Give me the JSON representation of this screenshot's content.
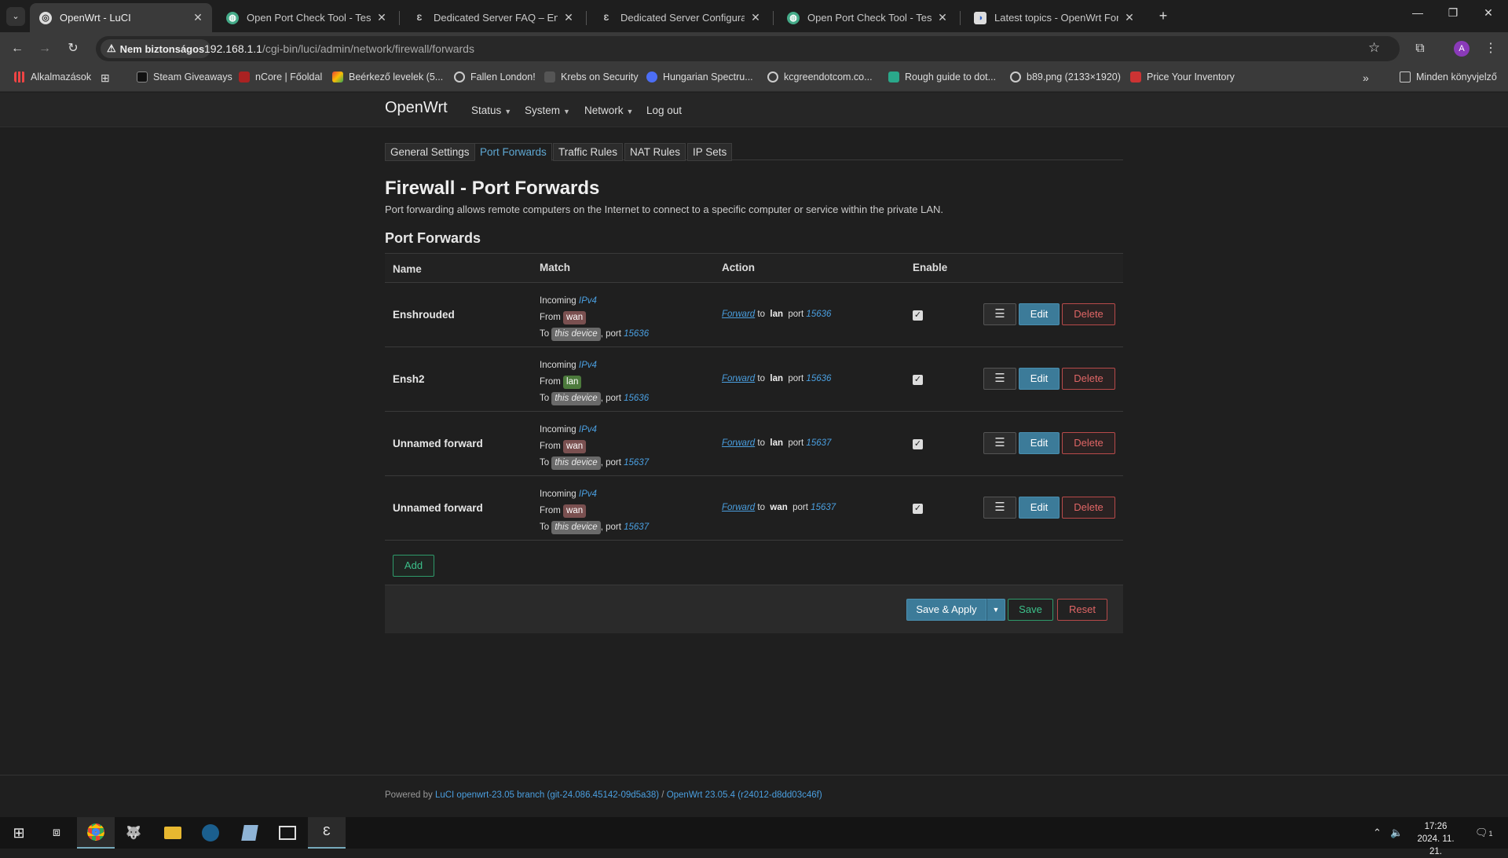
{
  "browser": {
    "tabs": [
      {
        "title": "OpenWrt - LuCI",
        "active": true
      },
      {
        "title": "Open Port Check Tool - Test Por",
        "active": false
      },
      {
        "title": "Dedicated Server FAQ – Enshrou",
        "active": false
      },
      {
        "title": "Dedicated Server Configuration",
        "active": false
      },
      {
        "title": "Open Port Check Tool - Test Por",
        "active": false
      },
      {
        "title": "Latest topics - OpenWrt Forum",
        "active": false
      }
    ],
    "new_tab": "+",
    "security_chip": "Nem biztonságos",
    "url_host": "192.168.1.1",
    "url_path": "/cgi-bin/luci/admin/network/firewall/forwards",
    "bookmarks": [
      "Alkalmazások",
      "Steam Giveaways",
      "nCore | Főoldal",
      "Beérkező levelek (5...",
      "Fallen London!",
      "Krebs on Security",
      "Hungarian Spectru...",
      "kcgreendotcom.co...",
      "Rough guide to dot...",
      "b89.png (2133×1920)",
      "Price Your Inventory"
    ],
    "bookmarks_folder": "Minden könyvjelző",
    "profile_initial": "A"
  },
  "luci": {
    "brand": "OpenWrt",
    "menu": [
      "Status",
      "System",
      "Network",
      "Log out"
    ],
    "subtabs": [
      "General Settings",
      "Port Forwards",
      "Traffic Rules",
      "NAT Rules",
      "IP Sets"
    ],
    "active_subtab": "Port Forwards",
    "title": "Firewall - Port Forwards",
    "description": "Port forwarding allows remote computers on the Internet to connect to a specific computer or service within the private LAN.",
    "section_title": "Port Forwards",
    "columns": [
      "Name",
      "Match",
      "Action",
      "Enable"
    ],
    "rules": [
      {
        "name": "Enshrouded",
        "family": "IPv4",
        "from_zone": "wan",
        "to": "this device",
        "port": "15636",
        "action": "Forward",
        "dest_zone": "lan",
        "dest_port": "15636",
        "enabled": true
      },
      {
        "name": "Ensh2",
        "family": "IPv4",
        "from_zone": "lan",
        "to": "this device",
        "port": "15636",
        "action": "Forward",
        "dest_zone": "lan",
        "dest_port": "15636",
        "enabled": true
      },
      {
        "name": "Unnamed forward",
        "family": "IPv4",
        "from_zone": "wan",
        "to": "this device",
        "port": "15637",
        "action": "Forward",
        "dest_zone": "lan",
        "dest_port": "15637",
        "enabled": true
      },
      {
        "name": "Unnamed forward",
        "family": "IPv4",
        "from_zone": "wan",
        "to": "this device",
        "port": "15637",
        "action": "Forward",
        "dest_zone": "wan",
        "dest_port": "15637",
        "enabled": true
      }
    ],
    "labels": {
      "incoming": "Incoming",
      "from": "From",
      "to": "To",
      "port": ", port",
      "to_word": "to",
      "port_word": "port",
      "edit": "Edit",
      "delete": "Delete",
      "add": "Add",
      "save_apply": "Save & Apply",
      "save": "Save",
      "reset": "Reset"
    },
    "footer": {
      "prefix": "Powered by ",
      "luci_link": "LuCI openwrt-23.05 branch (git-24.086.45142-09d5a38)",
      "sep": " / ",
      "openwrt_link": "OpenWrt 23.05.4 (r24012-d8dd03c46f)"
    }
  },
  "taskbar": {
    "time": "17:26",
    "date": "2024. 11. 21.",
    "notification_count": "1"
  },
  "colors": {
    "accent": "#3c7b99",
    "zone_wan": "#7a5050",
    "zone_lan": "#4c7a3c",
    "danger": "#e06666",
    "positive": "#3cc08a"
  }
}
